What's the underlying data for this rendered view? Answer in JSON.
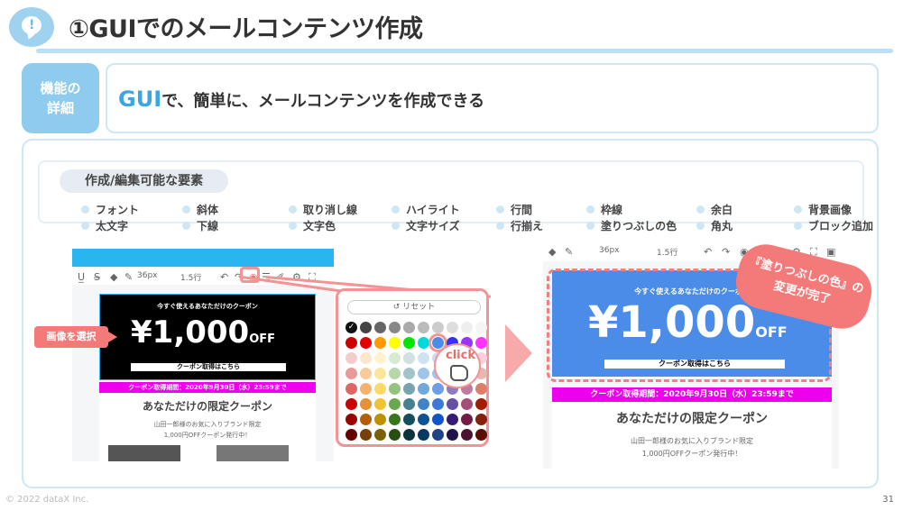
{
  "header": {
    "title": "①GUIでのメールコンテンツ作成"
  },
  "feature": {
    "tag_line1": "機能の",
    "tag_line2": "詳細",
    "text_gui": "GUI",
    "text_rest": "で、簡単に、メールコンテンツを作成できる"
  },
  "elements": {
    "title": "作成/編集可能な要素",
    "row1": [
      "フォント",
      "斜体",
      "取り消し線",
      "ハイライト",
      "行間",
      "枠線",
      "余白",
      "背景画像"
    ],
    "row2": [
      "太文字",
      "下線",
      "文字色",
      "文字サイズ",
      "行揃え",
      "塗りつぶしの色",
      "角丸",
      "ブロック追加"
    ]
  },
  "editor_left": {
    "toolbar_size": "36px",
    "toolbar_line": "1.5行",
    "headline": "今すぐ使えるあなただけのクーポン",
    "price": "¥1,000",
    "price_suffix": "OFF",
    "cta": "クーポン取得はこちら",
    "period": "クーポン取得期間：2020年9月30日（水）23:59まで",
    "subtitle": "あなただけの限定クーポン",
    "desc1": "山田一郎様のお気に入りブランド限定",
    "desc2": "1,000円OFFクーポン発行中！",
    "select_label": "画像を選択"
  },
  "palette": {
    "reset_label": "リセット",
    "click_label": "click",
    "colors": [
      [
        "#111111",
        "#444444",
        "#666666",
        "#888888",
        "#aaaaaa",
        "#bbbbbb",
        "#cccccc",
        "#dddddd",
        "#eeeeee",
        "#f5f5f5"
      ],
      [
        "#cc0000",
        "#e60000",
        "#ff9900",
        "#ffff00",
        "#00e600",
        "#00d9d9",
        "#4a8ce8",
        "#3333ff",
        "#9933ff",
        "#ff33ff"
      ],
      [
        "#f4cccc",
        "#fce5cd",
        "#fff2cc",
        "#d9ead3",
        "#d0e0e3",
        "#cfe2f3",
        "#c9daf8",
        "#d9d2e9",
        "#ead1dc",
        "#f8d0e0"
      ],
      [
        "#ea9999",
        "#f9cb9c",
        "#ffe599",
        "#b6d7a8",
        "#a2c4c9",
        "#9fc5e8",
        "#a4c2f4",
        "#b4a7d6",
        "#d5a6bd",
        "#e6b8af"
      ],
      [
        "#e06666",
        "#f6b26b",
        "#ffd966",
        "#93c47d",
        "#76a5af",
        "#6fa8dc",
        "#6d9eeb",
        "#8e7cc3",
        "#c27ba0",
        "#dd7e6b"
      ],
      [
        "#cc0000",
        "#e69138",
        "#f1c232",
        "#6aa84f",
        "#45818e",
        "#3d85c6",
        "#3c78d8",
        "#674ea7",
        "#a64d79",
        "#a61c00"
      ],
      [
        "#990000",
        "#b45f06",
        "#bf9000",
        "#38761d",
        "#134f5c",
        "#0b5394",
        "#1155cc",
        "#351c75",
        "#741b47",
        "#85200c"
      ],
      [
        "#660000",
        "#783f04",
        "#7f6000",
        "#274e13",
        "#0c343d",
        "#073763",
        "#1c4587",
        "#20124d",
        "#4c1130",
        "#5b0f00"
      ]
    ]
  },
  "editor_right": {
    "toolbar_size": "36px",
    "toolbar_line": "1.5行",
    "headline": "今すぐ使えるあなただけのクーポン",
    "price": "¥1,000",
    "price_suffix": "OFF",
    "cta": "クーポン取得はこちら",
    "period": "クーポン取得期間：2020年9月30日（水）23:59まで",
    "subtitle": "あなただけの限定クーポン",
    "desc1": "山田一郎様のお気に入りブランド限定",
    "desc2": "1,000円OFFクーポン発行中！",
    "balloon_line1": "『塗りつぶしの色』の",
    "balloon_line2": "変更が完了"
  },
  "footer": {
    "copyright": "© 2022 dataX Inc.",
    "page": "31"
  }
}
